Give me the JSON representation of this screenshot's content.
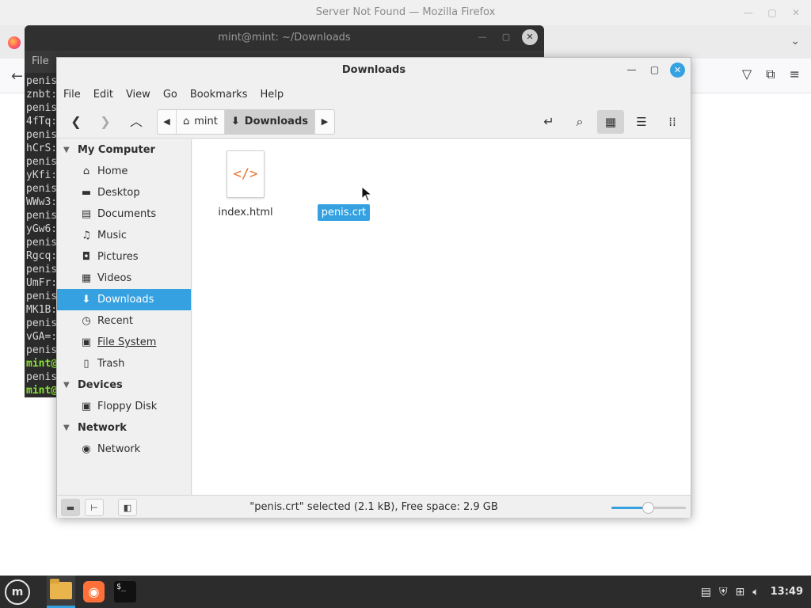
{
  "firefox": {
    "title": "Server Not Found — Mozilla Firefox"
  },
  "terminal": {
    "title": "mint@mint: ~/Downloads",
    "menu_file": "File",
    "lines": [
      {
        "text": "penis",
        "green": false
      },
      {
        "text": "znbt:",
        "green": false
      },
      {
        "text": "penis",
        "green": false
      },
      {
        "text": "4fTq:",
        "green": false
      },
      {
        "text": "penis",
        "green": false
      },
      {
        "text": "hCrS:",
        "green": false
      },
      {
        "text": "penis",
        "green": false
      },
      {
        "text": "yKfi:",
        "green": false
      },
      {
        "text": "penis",
        "green": false
      },
      {
        "text": "WWw3:",
        "green": false
      },
      {
        "text": "penis",
        "green": false
      },
      {
        "text": "yGw6:",
        "green": false
      },
      {
        "text": "penis",
        "green": false
      },
      {
        "text": "Rgcq:",
        "green": false
      },
      {
        "text": "penis",
        "green": false
      },
      {
        "text": "UmFr:",
        "green": false
      },
      {
        "text": "penis",
        "green": false
      },
      {
        "text": "MK1B:",
        "green": false
      },
      {
        "text": "penis",
        "green": false
      },
      {
        "text": "vGA=:",
        "green": false
      },
      {
        "text": "penis",
        "green": false
      },
      {
        "text": "mint@",
        "green": true
      },
      {
        "text": "penis",
        "green": false
      },
      {
        "text": "mint@",
        "green": true
      }
    ]
  },
  "file_manager": {
    "title": "Downloads",
    "menu": [
      "File",
      "Edit",
      "View",
      "Go",
      "Bookmarks",
      "Help"
    ],
    "path": [
      {
        "label": "mint",
        "icon": "home-icon"
      },
      {
        "label": "Downloads",
        "icon": "download-arrow-icon"
      }
    ],
    "sidebar": {
      "sections": [
        {
          "label": "My Computer",
          "items": [
            {
              "label": "Home",
              "icon": "home-icon",
              "glyph": "⌂"
            },
            {
              "label": "Desktop",
              "icon": "desktop-icon",
              "glyph": "▬"
            },
            {
              "label": "Documents",
              "icon": "documents-icon",
              "glyph": "▤"
            },
            {
              "label": "Music",
              "icon": "music-icon",
              "glyph": "♫"
            },
            {
              "label": "Pictures",
              "icon": "camera-icon",
              "glyph": "◘"
            },
            {
              "label": "Videos",
              "icon": "film-icon",
              "glyph": "▦"
            },
            {
              "label": "Downloads",
              "icon": "download-arrow-icon",
              "glyph": "⬇",
              "active": true
            },
            {
              "label": "Recent",
              "icon": "clock-icon",
              "glyph": "◷"
            },
            {
              "label": "File System",
              "icon": "drive-icon",
              "glyph": "▣",
              "underline": true
            },
            {
              "label": "Trash",
              "icon": "trash-icon",
              "glyph": "▯"
            }
          ]
        },
        {
          "label": "Devices",
          "items": [
            {
              "label": "Floppy Disk",
              "icon": "floppy-icon",
              "glyph": "▣"
            }
          ]
        },
        {
          "label": "Network",
          "items": [
            {
              "label": "Network",
              "icon": "globe-icon",
              "glyph": "◉"
            }
          ]
        }
      ]
    },
    "files": [
      {
        "name": "index.html",
        "icon": "html-file-icon",
        "glyph": "</>",
        "selected": false
      },
      {
        "name": "penis.crt",
        "icon": "certificate-file-icon",
        "glyph": "",
        "selected": true
      }
    ],
    "status_text": "\"penis.crt\" selected (2.1 kB), Free space: 2.9 GB",
    "zoom_level": 0.5
  },
  "taskbar": {
    "clock": "13:49",
    "menu_glyph": "m",
    "apps": [
      {
        "name": "files",
        "active": true
      },
      {
        "name": "firefox",
        "active": false
      },
      {
        "name": "terminal",
        "active": false
      }
    ],
    "terminal_prompt": "$_"
  },
  "colors": {
    "accent": "#35a1e0",
    "html_icon": "#e8702a",
    "terminal_prompt": "#8ae234"
  }
}
